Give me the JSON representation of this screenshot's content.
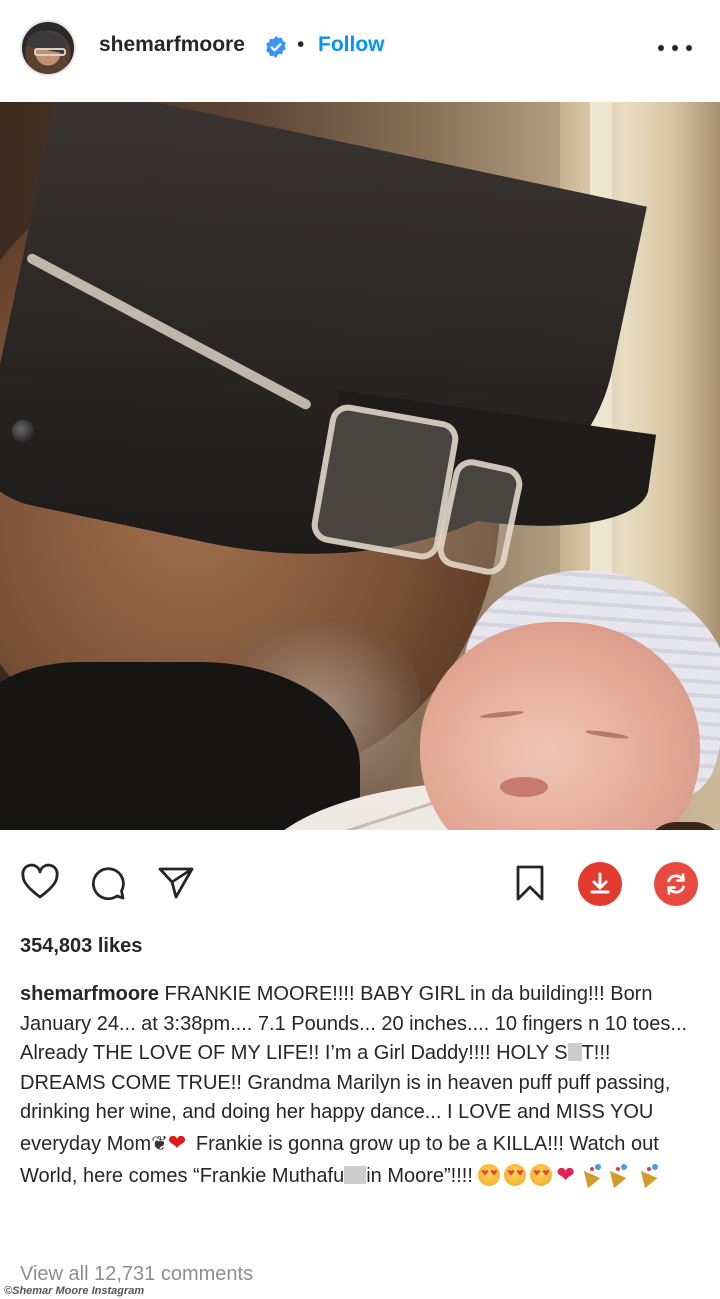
{
  "header": {
    "username": "shemarfmoore",
    "separator": "•",
    "follow_label": "Follow",
    "verified_icon": "verified-badge-icon",
    "more_icon": "more-options-icon"
  },
  "post": {
    "image_alt": "Photo of a man in a cap and clear glasses holding a newborn baby"
  },
  "actions": {
    "icons": [
      "heart-icon",
      "comment-icon",
      "share-icon",
      "bookmark-icon",
      "download-icon",
      "refresh-icon"
    ]
  },
  "likes": "354,803 likes",
  "caption": {
    "username": "shemarfmoore",
    "text_1": "FRANKIE MOORE!!!! BABY GIRL in da building!!! Born January 24... at 3:38pm.... 7.1 Pounds... 20 inches.... 10 fingers n 10 toes... Already THE LOVE OF MY LIFE!! I’m a Girl Daddy!!!! HOLY S",
    "text_2": "T!!! DREAMS COME TRUE!! Grandma Marilyn is in heaven puff puff passing, drinking her wine, and doing her happy dance... I LOVE and MISS YOU everyday Mom",
    "text_3": "Frankie is gonna grow up to be a KILLA!!! Watch out World, here comes “Frankie Muthafu",
    "text_4": "in Moore”!!!!"
  },
  "comments_link": "View all 12,731 comments",
  "credit": "©Shemar Moore Instagram",
  "colors": {
    "link_blue": "#0095f6",
    "text": "#262626",
    "muted": "#8e8e8e",
    "download_red": "#e23a2e",
    "heart_red": "#e0191e"
  }
}
